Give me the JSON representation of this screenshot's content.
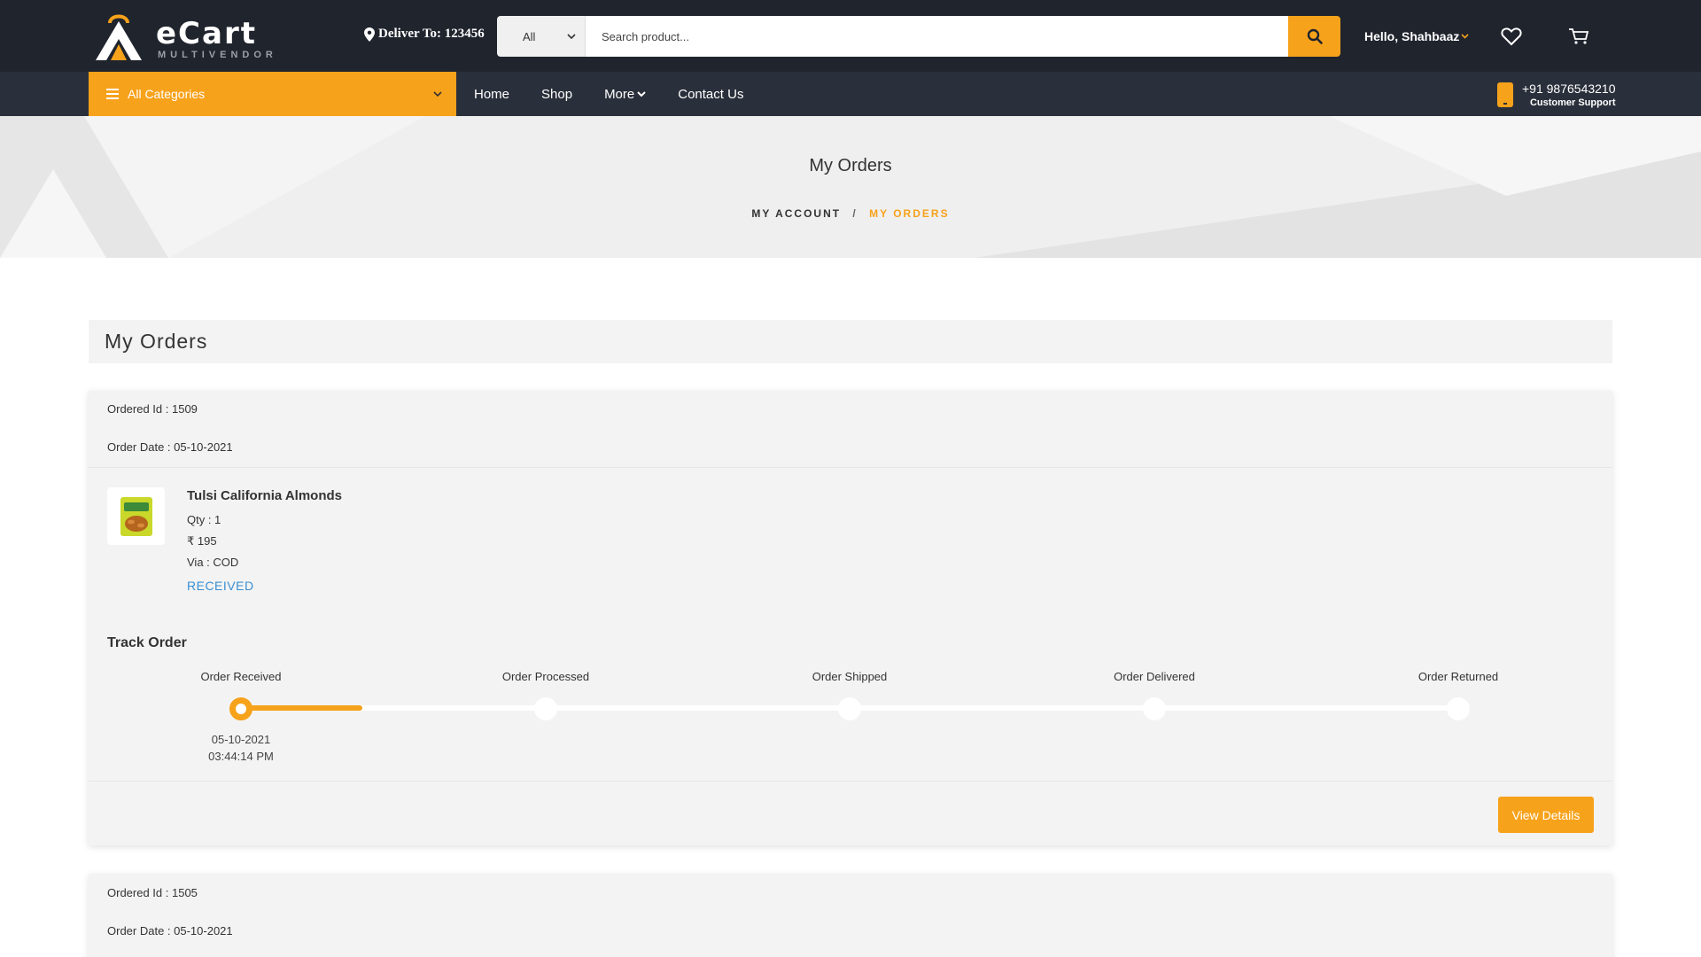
{
  "header": {
    "logo_text": "eCart",
    "logo_sub": "MULTIVENDOR",
    "deliver_to": "Deliver To: 123456",
    "search": {
      "category": "All",
      "placeholder": "Search product..."
    },
    "greeting": "Hello, Shahbaaz",
    "icons": [
      "map-pin-icon",
      "search-icon",
      "heart-icon",
      "cart-icon"
    ]
  },
  "nav": {
    "all_categories": "All Categories",
    "links": [
      "Home",
      "Shop",
      "More",
      "Contact Us"
    ],
    "support_phone": "+91 9876543210",
    "support_label": "Customer Support"
  },
  "banner": {
    "title": "My Orders",
    "breadcrumb": [
      "MY ACCOUNT",
      "MY ORDERS"
    ]
  },
  "main": {
    "section_title": "My Orders",
    "orders": [
      {
        "order_id": "Ordered Id : 1509",
        "order_date": "Order Date : 05-10-2021",
        "product": {
          "name": "Tulsi California Almonds",
          "qty": "Qty : 1",
          "price": "₹ 195",
          "via": "Via : COD",
          "status": "RECEIVED"
        },
        "track": {
          "title": "Track Order",
          "steps": [
            "Order Received",
            "Order Processed",
            "Order Shipped",
            "Order Delivered",
            "Order Returned"
          ],
          "completed_steps": 1,
          "progress": 0.1,
          "received_date": "05-10-2021",
          "received_time": "03:44:14 PM"
        },
        "button": "View Details"
      },
      {
        "order_id": "Ordered Id : 1505",
        "order_date": "Order Date : 05-10-2021"
      }
    ]
  },
  "colors": {
    "accent": "#f7a21b",
    "header_bg": "#1f242d",
    "nav_bg": "#2a303b",
    "status": "#3a8fd1"
  }
}
